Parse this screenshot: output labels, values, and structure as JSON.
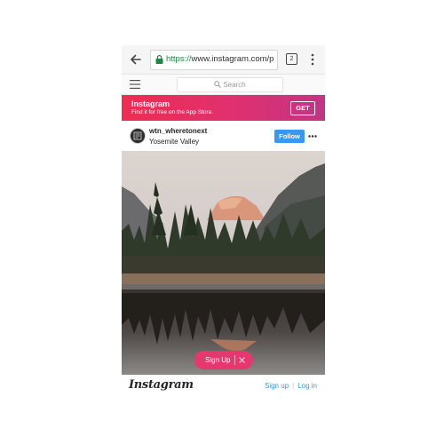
{
  "browser": {
    "url_scheme": "https://",
    "url_host": "www.instagram.com/p",
    "tab_count": "2"
  },
  "topbar": {
    "search_placeholder": "Search"
  },
  "promo": {
    "title": "Instagram",
    "subtitle": "Find it for free on the App Store.",
    "get_label": "GET"
  },
  "post": {
    "username": "wtn_wheretonext",
    "location": "Yosemite Valley",
    "follow_label": "Follow"
  },
  "overlay": {
    "signup_label": "Sign Up"
  },
  "footer": {
    "wordmark": "Instagram",
    "signup_link": "Sign up",
    "login_link": "Log in"
  },
  "colors": {
    "accent_blue": "#3897f0",
    "promo_pink": "#e0306f",
    "lock_green": "#1b8a3f"
  },
  "icons": [
    "back-arrow-icon",
    "lock-icon",
    "tabs-icon",
    "menu-dots-icon",
    "hamburger-icon",
    "search-icon",
    "more-icon",
    "close-icon"
  ]
}
